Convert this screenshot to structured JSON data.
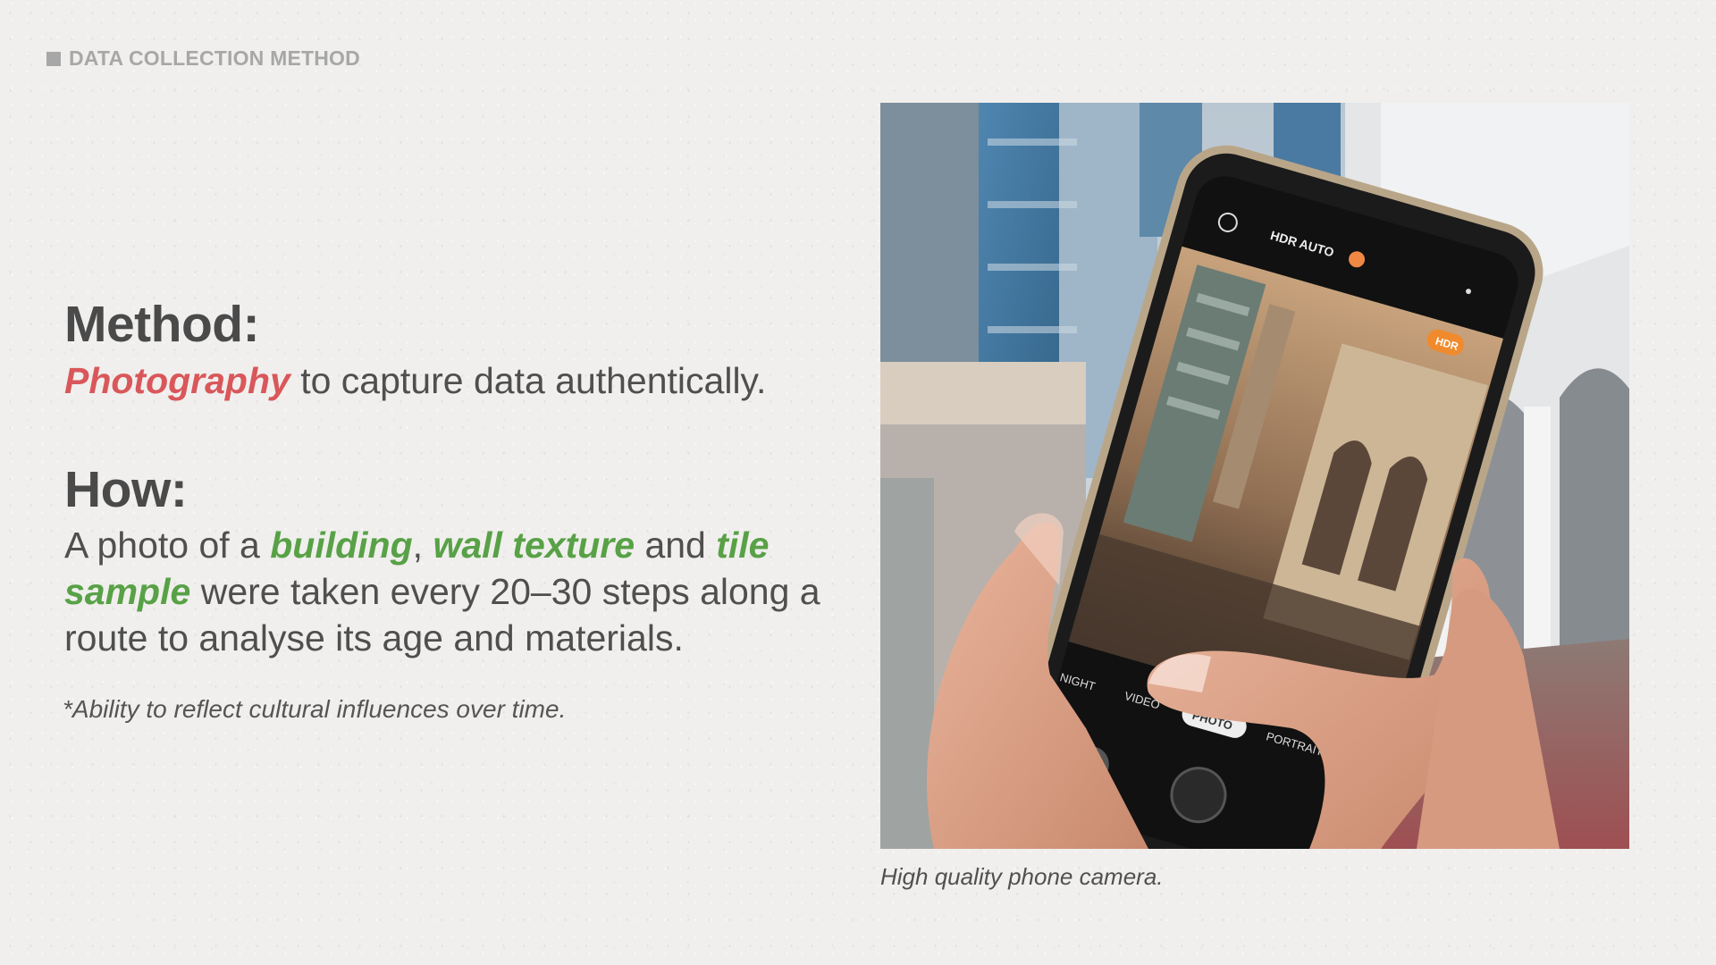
{
  "section_label": "DATA COLLECTION METHOD",
  "method": {
    "heading": "Method:",
    "highlight": "Photography",
    "rest": " to capture data authentically."
  },
  "how": {
    "heading": "How:",
    "segments": [
      {
        "text": "A photo of a ",
        "style": "plain"
      },
      {
        "text": "building",
        "style": "green"
      },
      {
        "text": ", ",
        "style": "plain"
      },
      {
        "text": "wall texture",
        "style": "green"
      },
      {
        "text": " and ",
        "style": "plain"
      },
      {
        "text": "tile sample",
        "style": "green"
      },
      {
        "text": " were taken every 20–30 steps along a route to analyse its age and materials.",
        "style": "plain"
      }
    ]
  },
  "footnote": "*Ability to reflect cultural influences over time.",
  "photo": {
    "camera_ui": {
      "hdr_auto": "HDR AUTO",
      "hdr_badge": "HDR",
      "modes": [
        "NIGHT",
        "VIDEO",
        "PHOTO",
        "PORTRAIT"
      ],
      "active_mode": "PHOTO"
    }
  },
  "caption": "High quality phone camera.",
  "colors": {
    "highlight_red": "#d9575a",
    "highlight_green": "#58a146",
    "label_gray": "#a7a7a7"
  }
}
